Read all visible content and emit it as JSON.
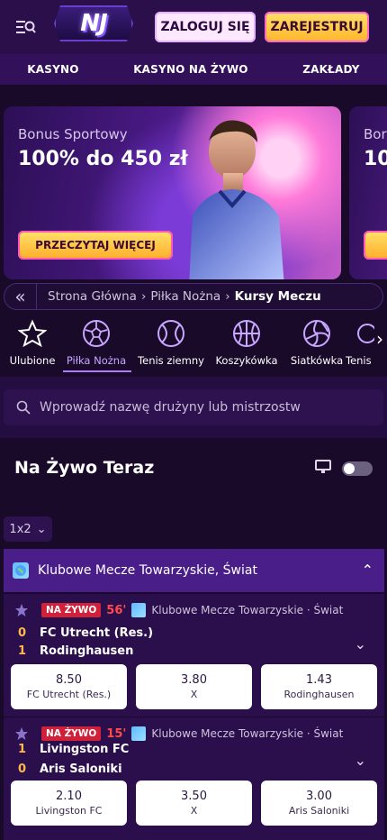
{
  "header": {
    "logo_text": "NJ",
    "login_label": "ZALOGUJ SIĘ",
    "register_label": "ZAREJESTRUJ"
  },
  "nav": [
    "KASYNO",
    "KASYNO NA ŻYWO",
    "ZAKŁADY"
  ],
  "banners": [
    {
      "subtitle": "Bonus Sportowy",
      "title": "100% do 450 zł",
      "cta": "PRZECZYTAJ WIĘCEJ"
    },
    {
      "subtitle": "Bor",
      "title": "10"
    }
  ],
  "breadcrumb": {
    "items": [
      "Strona Główna",
      "›",
      "Piłka Nożna",
      "›",
      "Kursy Meczu"
    ]
  },
  "sports": [
    {
      "label": "Ulubione",
      "icon": "star-icon"
    },
    {
      "label": "Piłka Nożna",
      "icon": "soccer-ball-icon",
      "active": true
    },
    {
      "label": "Tenis ziemny",
      "icon": "tennis-ball-icon"
    },
    {
      "label": "Koszykówka",
      "icon": "basketball-icon"
    },
    {
      "label": "Siatkówka",
      "icon": "volleyball-icon"
    },
    {
      "label": "Tenis"
    }
  ],
  "search": {
    "placeholder": "Wprowadź nazwę drużyny lub mistrzostw"
  },
  "live": {
    "title": "Na Żywo Teraz"
  },
  "bet_type": {
    "value": "1x2"
  },
  "league": {
    "name": "Klubowe Mecze Towarzyskie, Świat"
  },
  "matches": [
    {
      "badge": "NA ŻYWO",
      "minute": "56'",
      "competition": "Klubowe Mecze Towarzyskie · Świat",
      "home": {
        "score": "0",
        "name": "FC Utrecht (Res.)"
      },
      "away": {
        "score": "1",
        "name": "Rodinghausen"
      },
      "odds": [
        {
          "value": "8.50",
          "label": "FC Utrecht (Res.)"
        },
        {
          "value": "3.80",
          "label": "X"
        },
        {
          "value": "1.43",
          "label": "Rodinghausen"
        }
      ]
    },
    {
      "badge": "NA ŻYWO",
      "minute": "15'",
      "competition": "Klubowe Mecze Towarzyskie · Świat",
      "home": {
        "score": "1",
        "name": "Livingston FC"
      },
      "away": {
        "score": "0",
        "name": "Aris Saloniki"
      },
      "odds": [
        {
          "value": "2.10",
          "label": "Livingston FC"
        },
        {
          "value": "3.50",
          "label": "X"
        },
        {
          "value": "3.00",
          "label": "Aris Saloniki"
        }
      ]
    }
  ]
}
